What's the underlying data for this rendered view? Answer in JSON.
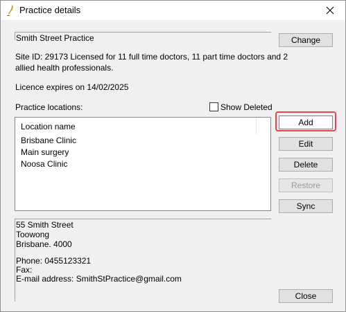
{
  "window": {
    "title": "Practice details"
  },
  "practice": {
    "name": "Smith Street Practice",
    "site_line1": "Site ID: 29173    Licensed for 11 full time doctors, 11 part time doctors and 2",
    "site_line2": "allied health professionals.",
    "licence_expiry": "Licence expires on 14/02/2025"
  },
  "locations": {
    "label": "Practice locations:",
    "show_deleted_label": "Show Deleted",
    "show_deleted_checked": false,
    "column_header": "Location name",
    "items": [
      "Brisbane Clinic",
      "Main surgery",
      "Noosa Clinic"
    ]
  },
  "address": {
    "street": "55 Smith Street",
    "suburb": "Toowong",
    "city_postcode": "Brisbane. 4000",
    "phone": "Phone:  0455123321",
    "fax": "Fax:",
    "email": "E-mail address:  SmithStPractice@gmail.com"
  },
  "buttons": {
    "change": "Change",
    "add": "Add",
    "edit": "Edit",
    "delete": "Delete",
    "restore": "Restore",
    "sync": "Sync",
    "close": "Close"
  },
  "colors": {
    "highlight": "#e0464a",
    "window_bg": "#f0f0f0",
    "button_bg": "#e1e1e1"
  },
  "icons": {
    "title": "app-quill-icon",
    "close": "close-x-icon"
  }
}
